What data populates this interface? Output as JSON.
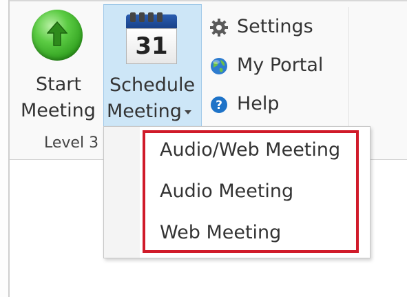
{
  "ribbon": {
    "start_meeting": {
      "line1": "Start",
      "line2": "Meeting",
      "icon": "arrow-up-green-circle-icon"
    },
    "schedule_meeting": {
      "line1": "Schedule",
      "line2": "Meeting",
      "calendar_day": "31",
      "icon": "calendar-icon"
    },
    "small_buttons": [
      {
        "label": "Settings",
        "icon": "gear-icon"
      },
      {
        "label": "My Portal",
        "icon": "globe-icon"
      },
      {
        "label": "Help",
        "icon": "help-icon"
      }
    ],
    "group_label": "Level 3"
  },
  "dropdown": {
    "items": [
      {
        "label": "Audio/Web Meeting"
      },
      {
        "label": "Audio Meeting"
      },
      {
        "label": "Web Meeting"
      }
    ]
  },
  "colors": {
    "selected_button_bg": "#cde6f7",
    "highlight_box": "#d01b2a",
    "start_icon_green": "#3fb52a",
    "help_icon_blue": "#1e73c8"
  }
}
